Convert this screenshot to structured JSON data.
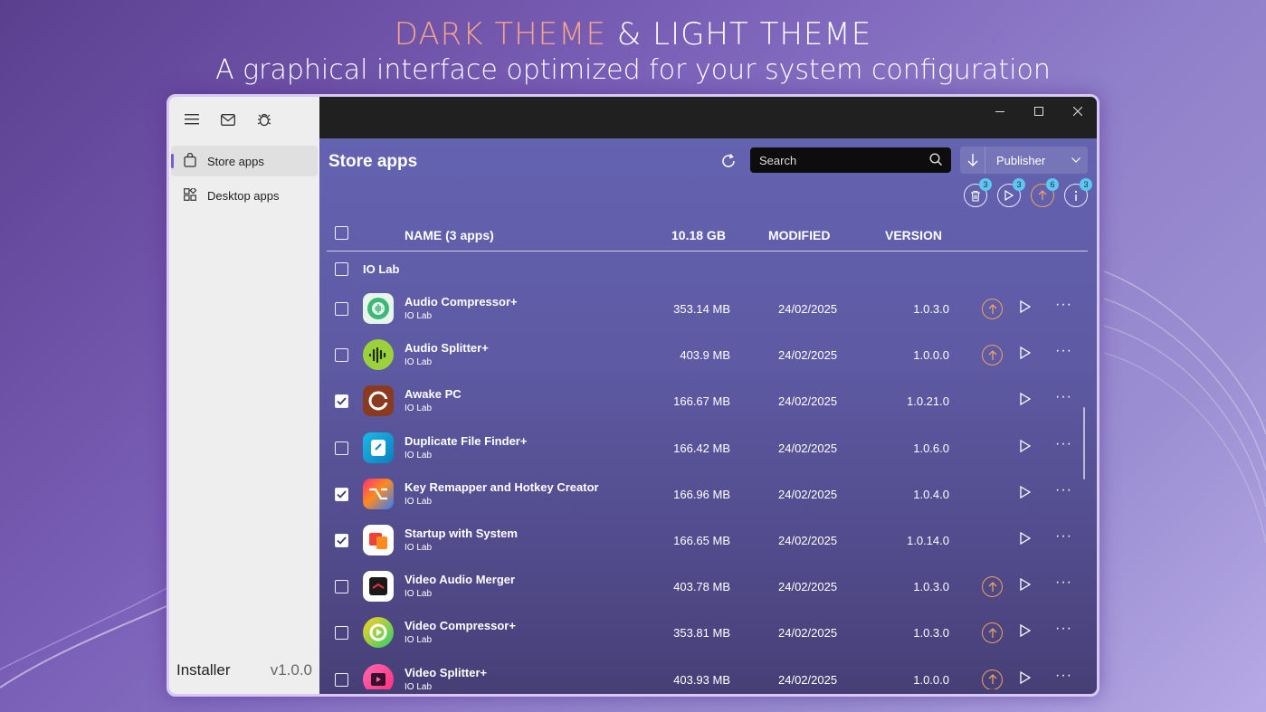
{
  "banner": {
    "line1_accent": "DARK THEME",
    "line1_rest": " & LIGHT THEME",
    "line2": "A graphical interface optimized for your system configuration"
  },
  "sidebar": {
    "icons": [
      "hamburger-menu-icon",
      "mail-icon",
      "bug-icon"
    ],
    "items": [
      {
        "label": "Store apps",
        "icon": "shopping-bag-icon",
        "active": true
      },
      {
        "label": "Desktop apps",
        "icon": "apps-grid-icon",
        "active": false
      }
    ],
    "footer_title": "Installer",
    "footer_version": "v1.0.0"
  },
  "titlebar": {
    "minimize": "—",
    "maximize": "☐",
    "close": "✕"
  },
  "main": {
    "title": "Store apps",
    "search_placeholder": "Search",
    "sort_label": "Publisher",
    "actions": [
      {
        "icon": "trash-icon",
        "badge": "3",
        "color": "#e8e8f4"
      },
      {
        "icon": "play-icon",
        "badge": "3",
        "color": "#e8e8f4"
      },
      {
        "icon": "update-icon",
        "badge": "6",
        "color": "#f0a060"
      },
      {
        "icon": "info-icon",
        "badge": "3",
        "color": "#e8e8f4"
      }
    ],
    "columns": {
      "name": "NAME (3 apps)",
      "size": "10.18 GB",
      "modified": "MODIFIED",
      "version": "VERSION"
    },
    "group": "IO Lab",
    "rows": [
      {
        "name": "Audio Compressor+",
        "publisher": "IO Lab",
        "size": "353.14 MB",
        "modified": "24/02/2025",
        "version": "1.0.3.0",
        "checked": false,
        "update": true
      },
      {
        "name": "Audio Splitter+",
        "publisher": "IO Lab",
        "size": "403.9 MB",
        "modified": "24/02/2025",
        "version": "1.0.0.0",
        "checked": false,
        "update": true
      },
      {
        "name": "Awake PC",
        "publisher": "IO Lab",
        "size": "166.67 MB",
        "modified": "24/02/2025",
        "version": "1.0.21.0",
        "checked": true,
        "update": false
      },
      {
        "name": "Duplicate File Finder+",
        "publisher": "IO Lab",
        "size": "166.42 MB",
        "modified": "24/02/2025",
        "version": "1.0.6.0",
        "checked": false,
        "update": false
      },
      {
        "name": "Key Remapper and Hotkey Creator",
        "publisher": "IO Lab",
        "size": "166.96 MB",
        "modified": "24/02/2025",
        "version": "1.0.4.0",
        "checked": true,
        "update": false
      },
      {
        "name": "Startup with System",
        "publisher": "IO Lab",
        "size": "166.65 MB",
        "modified": "24/02/2025",
        "version": "1.0.14.0",
        "checked": true,
        "update": false
      },
      {
        "name": "Video Audio Merger",
        "publisher": "IO Lab",
        "size": "403.78 MB",
        "modified": "24/02/2025",
        "version": "1.0.3.0",
        "checked": false,
        "update": true
      },
      {
        "name": "Video Compressor+",
        "publisher": "IO Lab",
        "size": "353.81 MB",
        "modified": "24/02/2025",
        "version": "1.0.3.0",
        "checked": false,
        "update": true
      },
      {
        "name": "Video Splitter+",
        "publisher": "IO Lab",
        "size": "403.93 MB",
        "modified": "24/02/2025",
        "version": "1.0.0.0",
        "checked": false,
        "update": true
      }
    ]
  }
}
